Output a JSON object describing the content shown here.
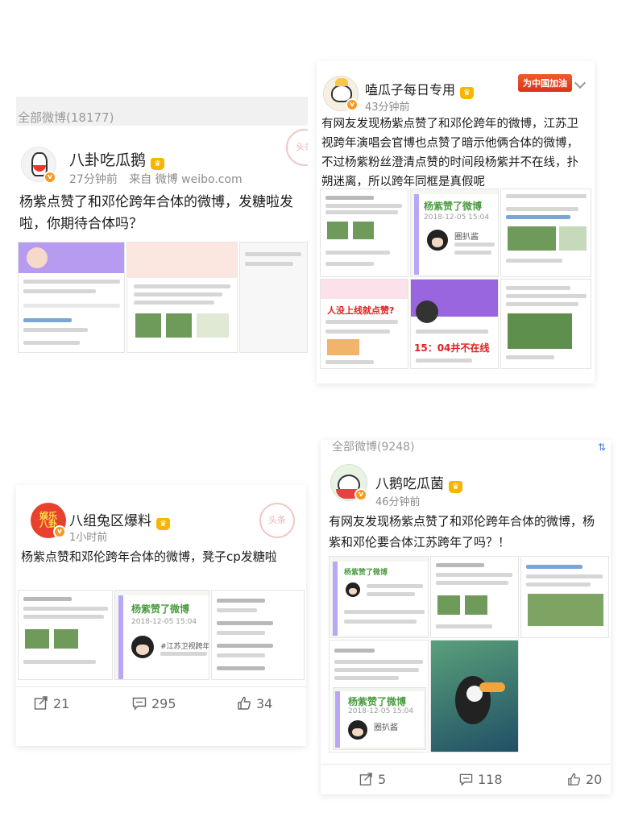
{
  "post1": {
    "feed_header": "全部微博(18177)",
    "author": "八卦吃瓜鹅",
    "time": "27分钟前",
    "source": "来自 微博 weibo.com",
    "text_line1": "杨紫点赞了和邓伦跨年合体的微博，发糖啦发",
    "text_line2": "啦，你期待合体吗？",
    "stamp": "头条"
  },
  "post2": {
    "author": "嗑瓜子每日专用",
    "time": "43分钟前",
    "text_line1": "有网友发现杨紫点赞了和邓伦跨年的微博，江苏卫",
    "text_line2": "视跨年演唱会官博也点赞了暗示他俩合体的微博，",
    "text_line3": "不过杨紫粉丝澄清点赞的时间段杨紫并不在线，扑",
    "text_line4": "朔迷离，所以跨年同框是真假呢",
    "join_badge": "为中国加油",
    "liked_title": "杨紫赞了微博",
    "liked_date": "2018-12-05 15:04",
    "liked_name": "圈扒酱",
    "overlay_red1": "人没上线就点赞?",
    "overlay_red2": "15：04并不在线"
  },
  "post3": {
    "author": "八组兔区爆料",
    "time": "1小时前",
    "text": "杨紫点赞和邓伦跨年合体的微博，凳子cp发糖啦",
    "liked_title": "杨紫赞了微博",
    "liked_date": "2018-12-05 15:04",
    "liked_sub": "#江苏卫视跨年#",
    "stamp": "头条",
    "reposts": "21",
    "comments": "295",
    "likes": "34"
  },
  "post4": {
    "feed_header": "全部微博(9248)",
    "author": "八鹅吃瓜菌",
    "time": "46分钟前",
    "text_line1": "有网友发现杨紫点赞了和邓伦跨年合体的微博，杨",
    "text_line2": "紫和邓伦要合体江苏跨年了吗？！",
    "liked_title": "杨紫赞了微博",
    "liked_date": "2018-12-05 15:04",
    "liked_name": "圈扒酱",
    "reposts": "5",
    "comments": "118",
    "likes": "20"
  }
}
